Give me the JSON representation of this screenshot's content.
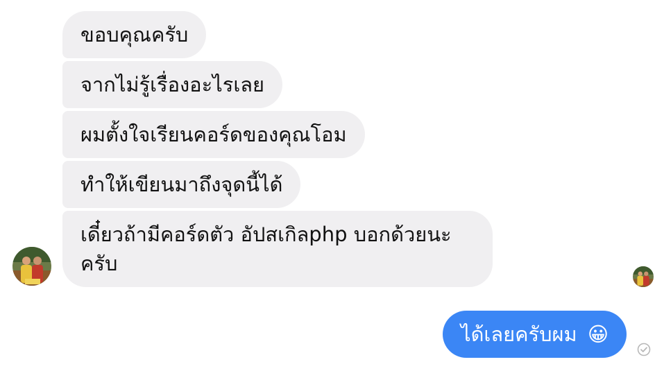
{
  "conversation": {
    "received": [
      "ขอบคุณครับ",
      "จากไม่รู้เรื่องอะไรเลย",
      "ผมตั้งใจเรียนคอร์ดของคุณโอม",
      "ทำให้เขียนมาถึงจุดนี้ได้",
      "เดี๋ยวถ้ามีคอร์ดตัว อัปสเกิลphp บอกด้วยนะครับ"
    ],
    "sent": {
      "text": "ได้เลยครับผม",
      "emoji": "😀"
    }
  },
  "icons": {
    "sender_avatar": "contact-avatar-icon",
    "seen_avatar": "read-receipt-avatar-icon",
    "delivered": "check-circle-icon"
  },
  "colors": {
    "received_bubble": "#f0eff1",
    "sent_bubble": "#3b86f5"
  }
}
